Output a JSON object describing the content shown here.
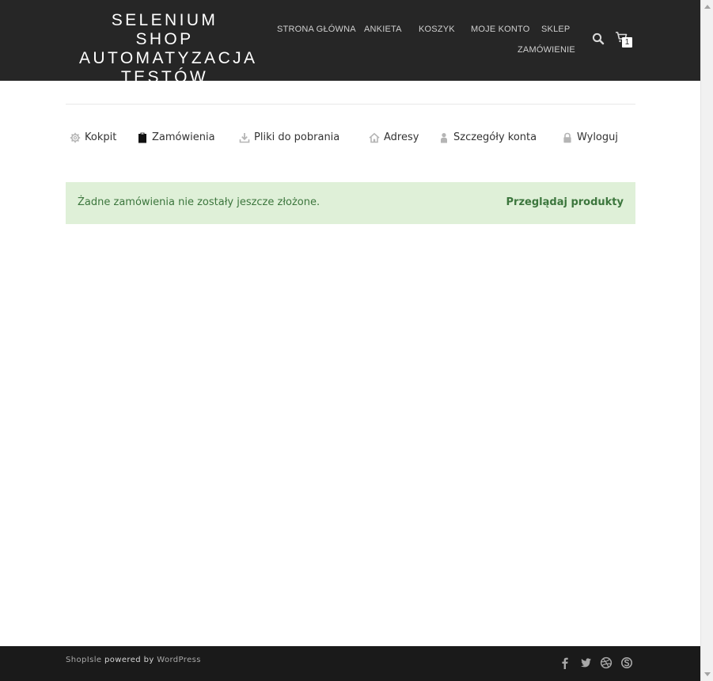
{
  "header": {
    "logo_line1": "SELENIUM SHOP",
    "logo_line2": "AUTOMATYZACJA",
    "logo_line3": "TESTÓW",
    "background": "#262626",
    "nav": [
      {
        "label": "STRONA GŁÓWNA"
      },
      {
        "label": "ANKIETA"
      },
      {
        "label": "KOSZYK"
      },
      {
        "label": "MOJE KONTO"
      },
      {
        "label": "SKLEP"
      },
      {
        "label": "ZAMÓWIENIE"
      }
    ],
    "search_icon": "search-icon",
    "cart_icon": "cart-icon",
    "cart_count": "1"
  },
  "account_nav": {
    "items": [
      {
        "label": "Kokpit",
        "icon": "gear-icon"
      },
      {
        "label": "Zamówienia",
        "icon": "clipboard-icon",
        "active": true
      },
      {
        "label": "Pliki do pobrania",
        "icon": "download-icon"
      },
      {
        "label": "Adresy",
        "icon": "home-icon"
      },
      {
        "label": "Szczegóły konta",
        "icon": "user-icon"
      },
      {
        "label": "Wyloguj",
        "icon": "lock-icon"
      }
    ]
  },
  "notice": {
    "text": "Żadne zamówienia nie zostały jeszcze złożone.",
    "button_label": "Przeglądaj produkty",
    "background": "#dff0d8",
    "color": "#3c763d"
  },
  "footer": {
    "credit_shop": "ShopIsle",
    "credit_mid": " powered by ",
    "credit_wp": "WordPress",
    "social": [
      "facebook-icon",
      "twitter-icon",
      "dribbble-icon",
      "skype-icon"
    ],
    "background": "#1a1a1a"
  }
}
